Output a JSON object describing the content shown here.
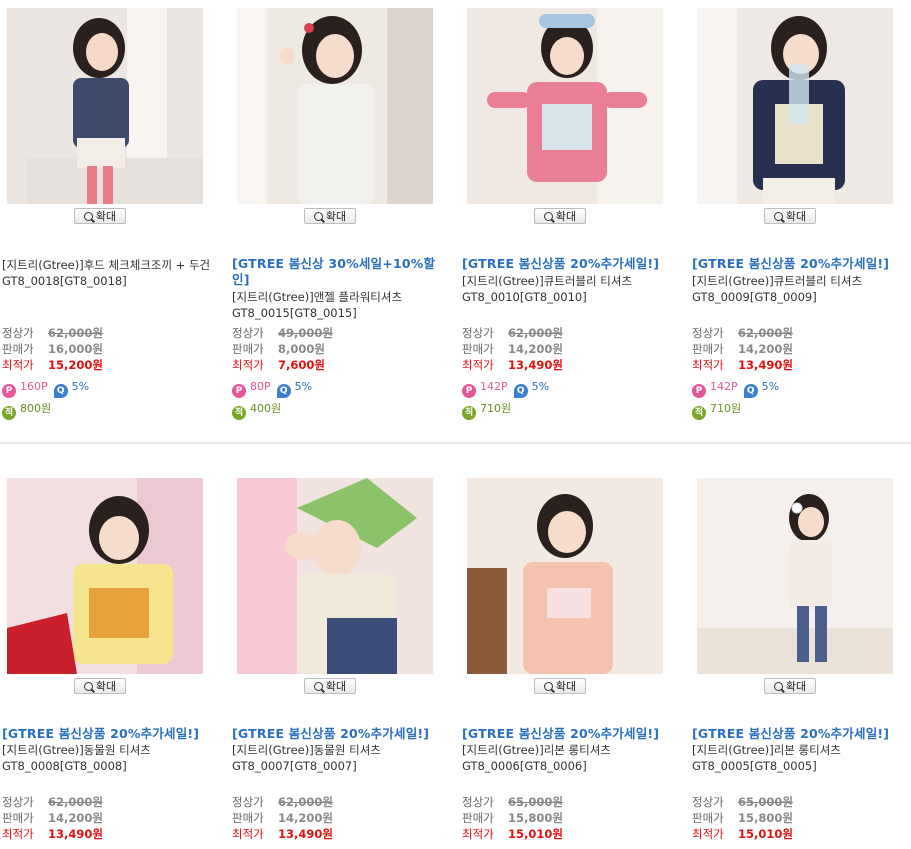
{
  "zoom_label": "확대",
  "price_labels": {
    "regular": "정상가",
    "sale": "판매가",
    "best": "최적가"
  },
  "products": [
    {
      "promo": "",
      "name": "[지트리(Gtree)]후드 체크체크조끼 + 두건 GT8_0018[GT8_0018]",
      "regular": "62,000원",
      "sale": "16,000원",
      "best": "15,200원",
      "points": "160P",
      "percent": "5%",
      "accum": "800원"
    },
    {
      "promo": "[GTREE 봄신상 30%세일+10%할인]",
      "name": "[지트리(Gtree)]앤젤 플라워티셔츠 GT8_0015[GT8_0015]",
      "regular": "49,000원",
      "sale": "8,000원",
      "best": "7,600원",
      "points": "80P",
      "percent": "5%",
      "accum": "400원"
    },
    {
      "promo": "[GTREE 봄신상품 20%추가세일!]",
      "name": "[지트리(Gtree)]큐트러블리 티셔츠 GT8_0010[GT8_0010]",
      "regular": "62,000원",
      "sale": "14,200원",
      "best": "13,490원",
      "points": "142P",
      "percent": "5%",
      "accum": "710원"
    },
    {
      "promo": "[GTREE 봄신상품 20%추가세일!]",
      "name": "[지트리(Gtree)]큐트러블리 티셔츠 GT8_0009[GT8_0009]",
      "regular": "62,000원",
      "sale": "14,200원",
      "best": "13,490원",
      "points": "142P",
      "percent": "5%",
      "accum": "710원"
    },
    {
      "promo": "[GTREE 봄신상품 20%추가세일!]",
      "name": "[지트리(Gtree)]동물원 티셔츠 GT8_0008[GT8_0008]",
      "regular": "62,000원",
      "sale": "14,200원",
      "best": "13,490원"
    },
    {
      "promo": "[GTREE 봄신상품 20%추가세일!]",
      "name": "[지트리(Gtree)]동물원 티셔츠 GT8_0007[GT8_0007]",
      "regular": "62,000원",
      "sale": "14,200원",
      "best": "13,490원"
    },
    {
      "promo": "[GTREE 봄신상품 20%추가세일!]",
      "name": "[지트리(Gtree)]리본 롱티셔츠 GT8_0006[GT8_0006]",
      "regular": "65,000원",
      "sale": "15,800원",
      "best": "15,010원"
    },
    {
      "promo": "[GTREE 봄신상품 20%추가세일!]",
      "name": "[지트리(Gtree)]리본 롱티셔츠 GT8_0005[GT8_0005]",
      "regular": "65,000원",
      "sale": "15,800원",
      "best": "15,010원"
    }
  ],
  "icons": {
    "points": "point-icon",
    "percent": "coupon-icon",
    "accum": "reserve-icon"
  },
  "colors": {
    "promo": "#2a6fc0",
    "best_price": "#e31010",
    "points": "#e8559a",
    "accum": "#7aa626"
  }
}
